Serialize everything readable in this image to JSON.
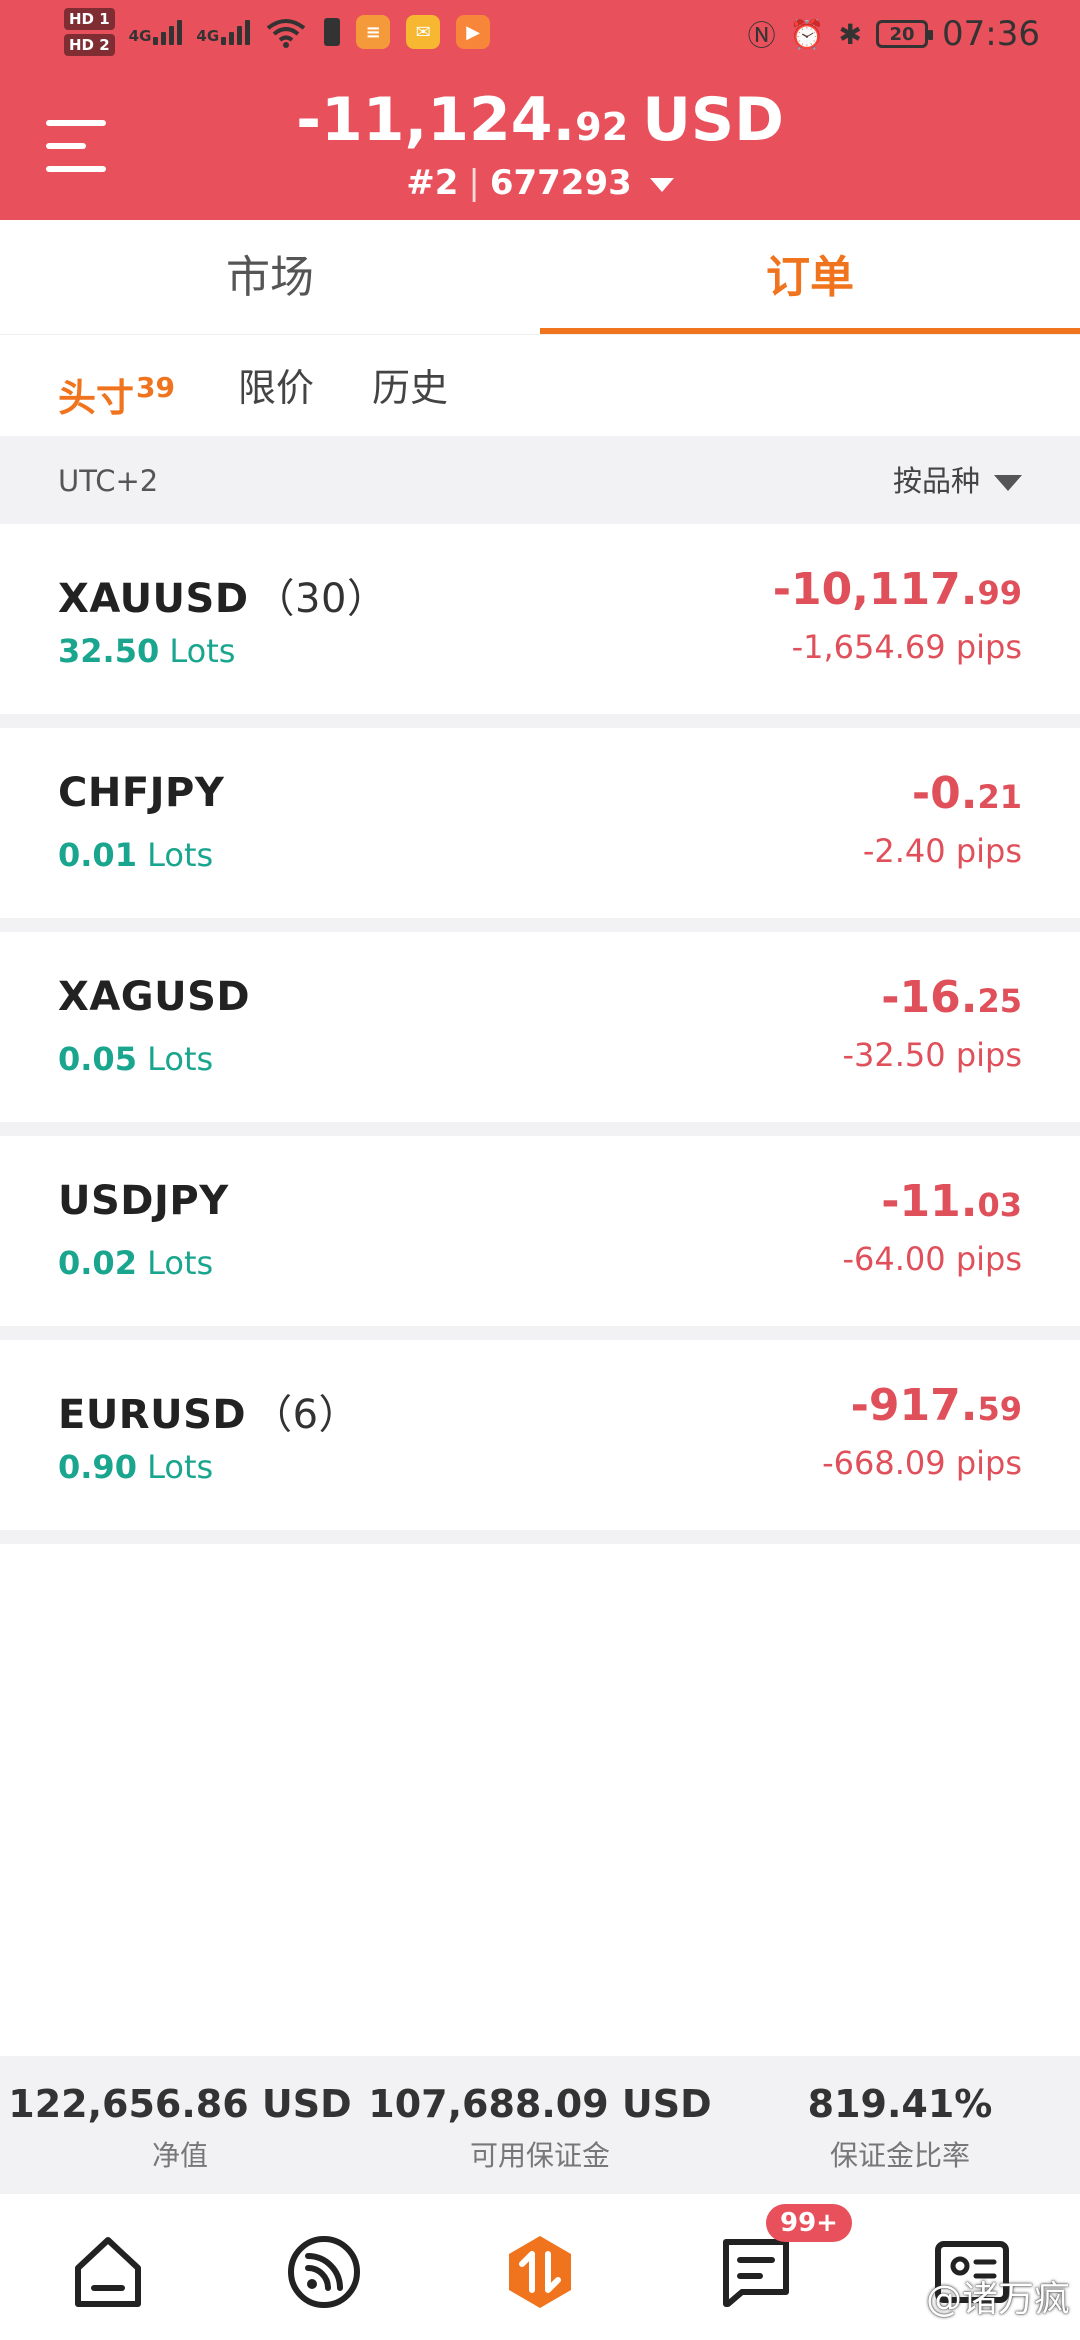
{
  "status_bar": {
    "hd1": "HD 1",
    "hd2": "HD 2",
    "net1": "4G",
    "net2": "4G",
    "battery_level": "20",
    "time": "07:36",
    "app_icon_colors": [
      "#f59a3a",
      "#f7b731",
      "#f7863a"
    ]
  },
  "header": {
    "balance_main": "-11,124.",
    "balance_decimals": "92",
    "currency": "USD",
    "account_prefix": "#2",
    "account_separator": "|",
    "account_number": "677293"
  },
  "main_tabs": [
    {
      "label": "市场",
      "active": false
    },
    {
      "label": "订单",
      "active": true
    }
  ],
  "sub_tabs": {
    "positions": {
      "label": "头寸",
      "count": "39"
    },
    "limit": {
      "label": "限价"
    },
    "history": {
      "label": "历史"
    }
  },
  "filter": {
    "timezone": "UTC+2",
    "sort_label": "按品种"
  },
  "positions": [
    {
      "symbol": "XAUUSD",
      "count": "（30）",
      "lots_value": "32.50",
      "lots_unit": "Lots",
      "pnl_main": "-10,117.",
      "pnl_decimals": "99",
      "pips": "-1,654.69 pips"
    },
    {
      "symbol": "CHFJPY",
      "count": "",
      "lots_value": "0.01",
      "lots_unit": "Lots",
      "pnl_main": "-0.",
      "pnl_decimals": "21",
      "pips": "-2.40 pips"
    },
    {
      "symbol": "XAGUSD",
      "count": "",
      "lots_value": "0.05",
      "lots_unit": "Lots",
      "pnl_main": "-16.",
      "pnl_decimals": "25",
      "pips": "-32.50 pips"
    },
    {
      "symbol": "USDJPY",
      "count": "",
      "lots_value": "0.02",
      "lots_unit": "Lots",
      "pnl_main": "-11.",
      "pnl_decimals": "03",
      "pips": "-64.00 pips"
    },
    {
      "symbol": "EURUSD",
      "count": "（6）",
      "lots_value": "0.90",
      "lots_unit": "Lots",
      "pnl_main": "-917.",
      "pnl_decimals": "59",
      "pips": "-668.09 pips"
    }
  ],
  "summary": {
    "equity": {
      "value": "122,656.86 USD",
      "label": "净值"
    },
    "free_margin": {
      "value": "107,688.09 USD",
      "label": "可用保证金"
    },
    "margin_level": {
      "value": "819.41%",
      "label": "保证金比率"
    }
  },
  "bottom_nav": {
    "items": [
      "home-icon",
      "feed-icon",
      "trade-icon",
      "messages-icon",
      "profile-card-icon"
    ],
    "badge": "99+",
    "active_color": "#f0741e"
  },
  "watermark": "@诸万疯",
  "colors": {
    "header_bg": "#e8505b",
    "accent": "#f0741e",
    "loss": "#e0505a",
    "lots": "#1aa68e"
  }
}
